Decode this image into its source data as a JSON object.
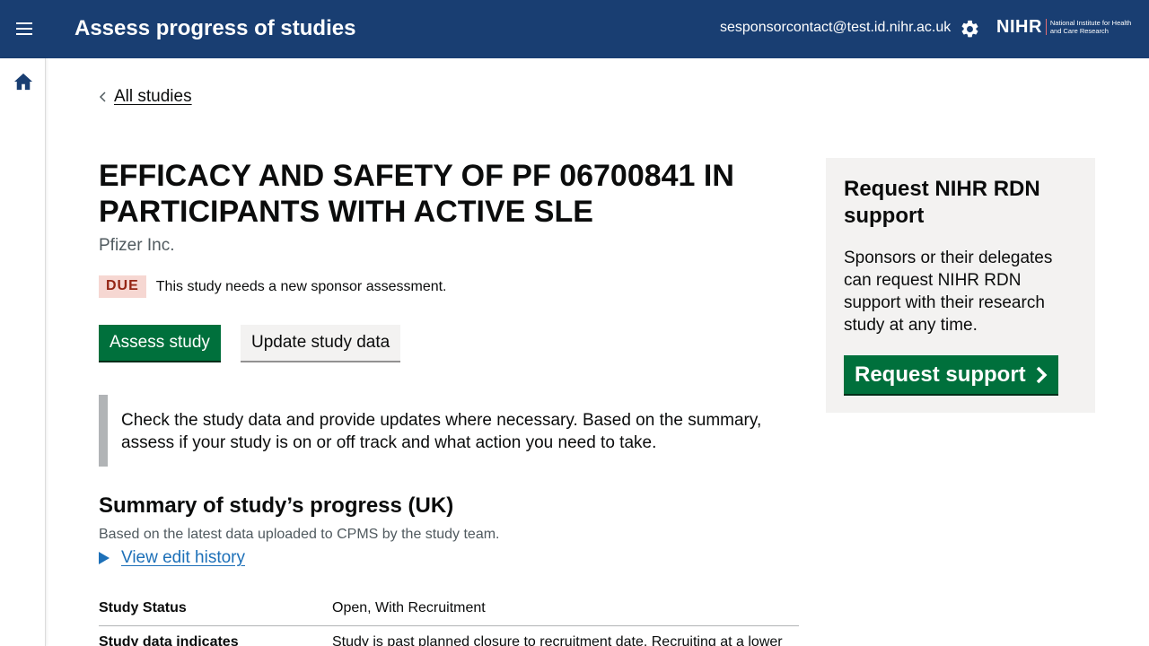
{
  "header": {
    "app_title": "Assess progress of studies",
    "user_email": "sesponsorcontact@test.id.nihr.ac.uk",
    "logo_mark": "NIHR",
    "logo_text": "National Institute for Health and Care Research",
    "icons": [
      "menu-icon",
      "gear-icon"
    ]
  },
  "sidebar": {
    "icons": [
      "home-icon"
    ]
  },
  "breadcrumb": {
    "back_label": "All studies"
  },
  "study": {
    "title": "EFFICACY AND SAFETY OF PF 06700841 IN PARTICIPANTS WITH ACTIVE SLE",
    "sponsor": "Pfizer Inc.",
    "status_tag": "DUE",
    "status_text": "This study needs a new sponsor assessment."
  },
  "actions": {
    "assess_label": "Assess study",
    "update_label": "Update study data"
  },
  "inset_text": "Check the study data and provide updates where necessary. Based on the summary, assess if your study is on or off track and what action you need to take.",
  "summary": {
    "heading": "Summary of study’s progress (UK)",
    "subtext": "Based on the latest data uploaded to CPMS by the study team.",
    "history_link": "View edit history",
    "rows": [
      {
        "key": "Study Status",
        "value": "Open, With Recruitment"
      },
      {
        "key": "Study data indicates",
        "value": "Study is past planned closure to recruitment date. Recruiting at a lower"
      }
    ]
  },
  "support_panel": {
    "title": "Request NIHR RDN support",
    "body": "Sponsors or their delegates can request NIHR RDN support with their research study at any time.",
    "button_label": "Request support"
  },
  "colors": {
    "header_bg": "#193e72",
    "primary_button": "#00703c",
    "link": "#1d70b8",
    "due_tag_bg": "#f6d7d2",
    "due_tag_text": "#942514",
    "panel_bg": "#f3f2f1"
  }
}
